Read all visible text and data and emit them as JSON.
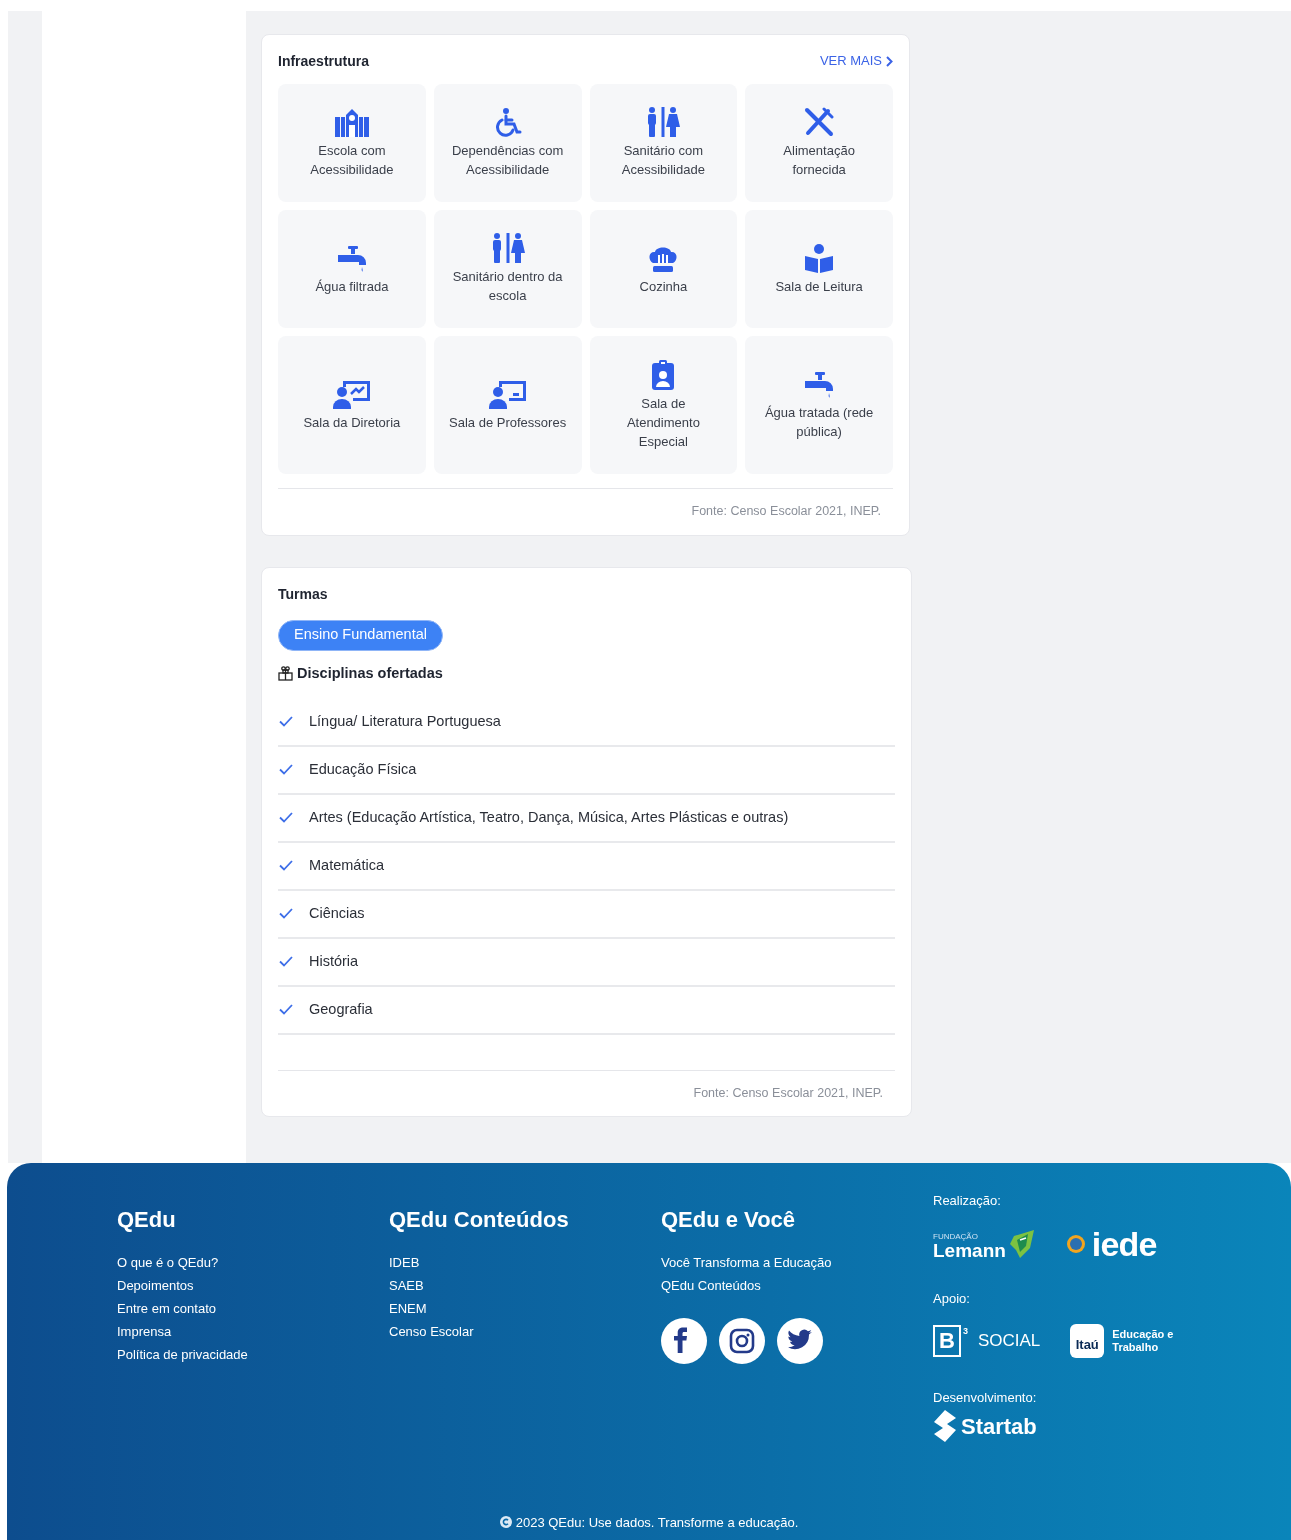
{
  "infraestrutura": {
    "title": "Infraestrutura",
    "more_link": "VER MAIS",
    "items": [
      {
        "label": "Escola com Acessibilidade"
      },
      {
        "label": "Dependências com Acessibilidade"
      },
      {
        "label": "Sanitário com Acessibilidade"
      },
      {
        "label": "Alimentação fornecida"
      },
      {
        "label": "Água filtrada"
      },
      {
        "label": "Sanitário dentro da escola"
      },
      {
        "label": "Cozinha"
      },
      {
        "label": "Sala de Leitura"
      },
      {
        "label": "Sala da Diretoria"
      },
      {
        "label": "Sala de Professores"
      },
      {
        "label": "Sala de Atendimento Especial"
      },
      {
        "label": "Água tratada (rede pública)"
      }
    ],
    "source": "Fonte: Censo Escolar 2021, INEP."
  },
  "turmas": {
    "title": "Turmas",
    "levels": [
      {
        "label": "Ensino Fundamental",
        "selected": true
      }
    ],
    "subjects_title": "Disciplinas ofertadas",
    "subjects": [
      {
        "label": "Língua/ Literatura Portuguesa",
        "checked": true
      },
      {
        "label": "Educação Física",
        "checked": true
      },
      {
        "label": "Artes (Educação Artística, Teatro, Dança, Música, Artes Plásticas e outras)",
        "checked": true
      },
      {
        "label": "Matemática",
        "checked": true
      },
      {
        "label": "Ciências",
        "checked": true
      },
      {
        "label": "História",
        "checked": true
      },
      {
        "label": "Geografia",
        "checked": true
      }
    ],
    "source": "Fonte: Censo Escolar 2021, INEP."
  },
  "footer": {
    "columns": [
      {
        "title": "QEdu",
        "links": [
          "O que é o QEdu?",
          "Depoimentos",
          "Entre em contato",
          "Imprensa",
          "Política de privacidade"
        ]
      },
      {
        "title": "QEdu Conteúdos",
        "links": [
          "IDEB",
          "SAEB",
          "ENEM",
          "Censo Escolar"
        ]
      },
      {
        "title": "QEdu e Você",
        "links": [
          "Você Transforma a Educação",
          "QEdu Conteúdos"
        ]
      }
    ],
    "realizacao": "Realização:",
    "lemann_small": "FUNDAÇÃO",
    "lemann": "Lemann",
    "iede": "iede",
    "apoio": "Apoio:",
    "b3": "B",
    "b3_sup": "3",
    "b3_social": "SOCIAL",
    "itau": "Itaú",
    "itau_text": "Educação e Trabalho",
    "desenvolvimento": "Desenvolvimento:",
    "startab": "Startab",
    "copyright": "2023 QEdu: Use dados. Transforme a educação."
  }
}
